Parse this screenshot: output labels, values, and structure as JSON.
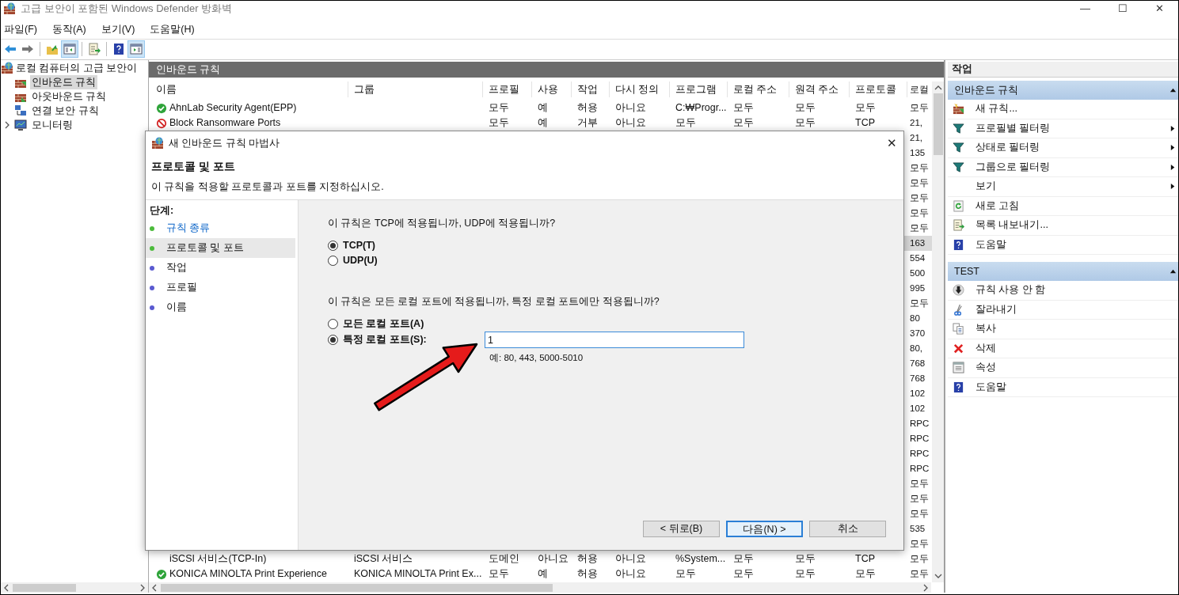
{
  "window": {
    "title": "고급 보안이 포함된 Windows Defender 방화벽",
    "controls": [
      "—",
      "☐",
      "✕"
    ]
  },
  "menu": [
    "파일(F)",
    "동작(A)",
    "보기(V)",
    "도움말(H)"
  ],
  "toolbar": [
    [
      {
        "kind": "back",
        "selected": false
      },
      {
        "kind": "forward",
        "selected": false
      }
    ],
    [
      {
        "kind": "up",
        "selected": false
      },
      {
        "kind": "tree",
        "selected": true
      }
    ],
    [
      {
        "kind": "export",
        "selected": false
      }
    ],
    [
      {
        "kind": "help",
        "selected": false
      },
      {
        "kind": "pane",
        "selected": true
      }
    ]
  ],
  "tree": {
    "label": "로컬 컴퓨터의 고급 보안이",
    "children": [
      {
        "label": "인바운드 규칙",
        "kind": "inbound",
        "selected": true
      },
      {
        "label": "아웃바운드 규칙",
        "kind": "outbound",
        "selected": false
      },
      {
        "label": "연결 보안 규칙",
        "kind": "connection",
        "selected": false
      },
      {
        "label": "모니터링",
        "kind": "monitor",
        "selected": false,
        "expanded": false
      }
    ]
  },
  "table": {
    "title": "인바운드 규칙",
    "columns": [
      "이름",
      "그룹",
      "프로필",
      "사용",
      "작업",
      "다시 정의",
      "프로그램",
      "로컬 주소",
      "원격 주소",
      "프로토콜",
      "로컬"
    ],
    "rows": [
      {
        "kind": "allow",
        "cells": [
          "AhnLab Security Agent(EPP)",
          "",
          "모두",
          "예",
          "허용",
          "아니요",
          "C:₩Progr...",
          "모두",
          "모두",
          "모두",
          "모두"
        ],
        "selected": false
      },
      {
        "kind": "block",
        "cells": [
          "Block Ransomware Ports",
          "",
          "모두",
          "예",
          "거부",
          "아니요",
          "모두",
          "모두",
          "모두",
          "TCP",
          "21,"
        ],
        "selected": false
      },
      {
        "local_port": "21,",
        "selected": false
      },
      {
        "local_port": "135",
        "selected": false
      },
      {
        "local_port": "모두",
        "selected": false
      },
      {
        "local_port": "모두",
        "selected": false
      },
      {
        "local_port": "모두",
        "selected": false
      },
      {
        "local_port": "모두",
        "selected": false
      },
      {
        "local_port": "모두",
        "selected": false
      },
      {
        "local_port": "163",
        "selected": true
      },
      {
        "local_port": "554",
        "selected": false
      },
      {
        "local_port": "500",
        "selected": false
      },
      {
        "local_port": "995",
        "selected": false
      },
      {
        "local_port": "모두",
        "selected": false
      },
      {
        "local_port": "80",
        "selected": false
      },
      {
        "local_port": "370",
        "selected": false
      },
      {
        "local_port": "80,",
        "selected": false
      },
      {
        "local_port": "768",
        "selected": false
      },
      {
        "local_port": "768",
        "selected": false
      },
      {
        "local_port": "102",
        "selected": false
      },
      {
        "local_port": "102",
        "selected": false
      },
      {
        "local_port": "RPC",
        "selected": false
      },
      {
        "local_port": "RPC",
        "selected": false
      },
      {
        "local_port": "RPC",
        "selected": false
      },
      {
        "local_port": "RPC",
        "selected": false
      },
      {
        "local_port": "모두",
        "selected": false
      },
      {
        "local_port": "모두",
        "selected": false
      },
      {
        "local_port": "모두",
        "selected": false
      },
      {
        "local_port": "535",
        "selected": false
      },
      {
        "local_port": "모두",
        "selected": false
      },
      {
        "kind": "disabled",
        "cells": [
          "iSCSI 서비스(TCP-In)",
          "iSCSI 서비스",
          "도메인",
          "아니요",
          "허용",
          "아니요",
          "%System...",
          "모두",
          "모두",
          "TCP",
          "모두"
        ],
        "selected": false
      },
      {
        "kind": "allow",
        "cells": [
          "KONICA MINOLTA Print Experience",
          "KONICA MINOLTA Print Ex...",
          "모두",
          "예",
          "허용",
          "아니요",
          "모두",
          "모두",
          "모두",
          "모두",
          "모두"
        ],
        "selected": false
      }
    ]
  },
  "actions": {
    "title": "작업",
    "sections": [
      {
        "title": "인바운드 규칙",
        "expanded": true,
        "items": [
          {
            "label": "새 규칙...",
            "kind": "new",
            "submenu": false
          },
          {
            "label": "프로필별 필터링",
            "kind": "filter",
            "submenu": true
          },
          {
            "label": "상태로 필터링",
            "kind": "filter",
            "submenu": true
          },
          {
            "label": "그룹으로 필터링",
            "kind": "filter",
            "submenu": true
          },
          {
            "label": "보기",
            "kind": "view",
            "submenu": true
          },
          {
            "label": "새로 고침",
            "kind": "refresh",
            "submenu": false
          },
          {
            "label": "목록 내보내기...",
            "kind": "export",
            "submenu": false
          },
          {
            "label": "도움말",
            "kind": "help",
            "submenu": false
          }
        ]
      },
      {
        "title": "TEST",
        "expanded": true,
        "items": [
          {
            "label": "규칙 사용 안 함",
            "kind": "disable",
            "submenu": false
          },
          {
            "label": "잘라내기",
            "kind": "cut",
            "submenu": false
          },
          {
            "label": "복사",
            "kind": "copy",
            "submenu": false
          },
          {
            "label": "삭제",
            "kind": "delete",
            "submenu": false
          },
          {
            "label": "속성",
            "kind": "properties",
            "submenu": false
          },
          {
            "label": "도움말",
            "kind": "help",
            "submenu": false
          }
        ]
      }
    ]
  },
  "dialog": {
    "title": "새 인바운드 규칙 마법사",
    "close": "✕",
    "heading": "프로토콜 및 포트",
    "subtitle": "이 규칙을 적용할 프로토콜과 포트를 지정하십시오.",
    "steps_title": "단계:",
    "steps": [
      {
        "label": "규칙 종류",
        "kind": "done",
        "link": true,
        "selected": false
      },
      {
        "label": "프로토콜 및 포트",
        "kind": "done",
        "link": false,
        "selected": true
      },
      {
        "label": "작업",
        "kind": "pending",
        "link": false,
        "selected": false
      },
      {
        "label": "프로필",
        "kind": "pending",
        "link": false,
        "selected": false
      },
      {
        "label": "이름",
        "kind": "pending",
        "link": false,
        "selected": false
      }
    ],
    "protocol_question": "이 규칙은 TCP에 적용됩니까, UDP에 적용됩니까?",
    "protocols": [
      {
        "label": "TCP(T)",
        "selected": true
      },
      {
        "label": "UDP(U)",
        "selected": false
      }
    ],
    "port_question": "이 규칙은 모든 로컬 포트에 적용됩니까, 특정 로컬 포트에만 적용됩니까?",
    "port_options": [
      {
        "label": "모든 로컬 포트(A)",
        "selected": false
      },
      {
        "label": "특정 로컬 포트(S):",
        "selected": true
      }
    ],
    "port_value": "1",
    "port_hint": "예: 80, 443, 5000-5010",
    "buttons": [
      {
        "label": "< 뒤로(B)",
        "default": false
      },
      {
        "label": "다음(N) >",
        "default": true
      },
      {
        "label": "취소",
        "default": false
      }
    ]
  }
}
